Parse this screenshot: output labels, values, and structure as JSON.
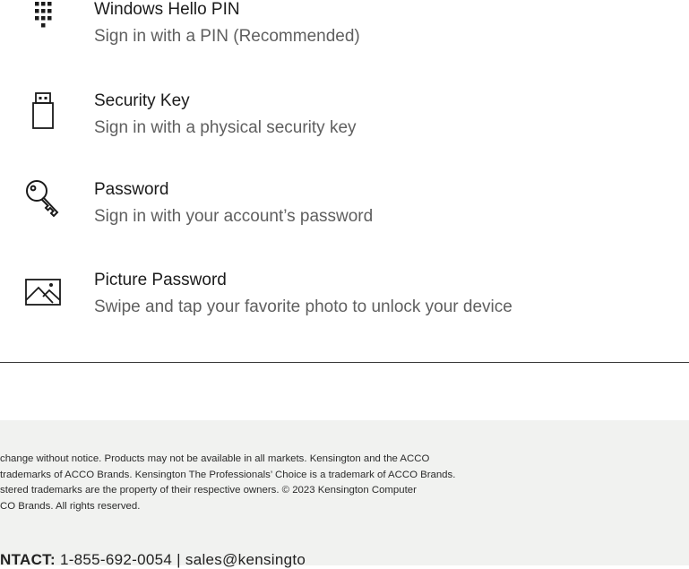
{
  "signin_options": [
    {
      "icon": "keypad-icon",
      "title": "Windows Hello PIN",
      "description": "Sign in with a PIN (Recommended)"
    },
    {
      "icon": "usb-key-icon",
      "title": "Security Key",
      "description": "Sign in with a physical security key"
    },
    {
      "icon": "key-icon",
      "title": "Password",
      "description": "Sign in with your account’s password"
    },
    {
      "icon": "picture-icon",
      "title": "Picture Password",
      "description": "Swipe and tap your favorite photo to unlock your device"
    }
  ],
  "footer": {
    "legal_lines": [
      "change without notice. Products may not be available in all markets. Kensington and the ACCO",
      "trademarks of ACCO Brands. Kensington The Professionals’ Choice is a trademark of ACCO Brands.",
      "stered trademarks are the property of their respective owners. © 2023 Kensington Computer",
      "CO Brands. All rights reserved."
    ],
    "contact_label": "NTACT:",
    "contact_text": "1-855-692-0054 | sales@kensingto"
  },
  "colors": {
    "footer_bg": "#f1f2f0",
    "divider": "#3a3a3a",
    "title_text": "#1b1b1b",
    "desc_text": "#5f5f5f"
  }
}
